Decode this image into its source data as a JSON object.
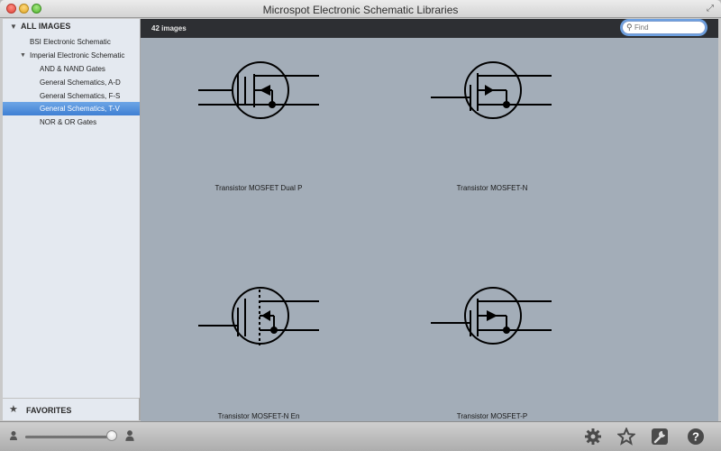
{
  "window": {
    "title": "Microspot Electronic Schematic Libraries"
  },
  "sidebar": {
    "header": "ALL IMAGES",
    "items": [
      {
        "label": "BSI Electronic Schematic"
      },
      {
        "label": "Imperial Electronic Schematic"
      },
      {
        "label": "AND & NAND Gates"
      },
      {
        "label": "General Schematics, A-D"
      },
      {
        "label": "General Schematics, F-S"
      },
      {
        "label": "General Schematics, T-V"
      },
      {
        "label": "NOR & OR Gates"
      }
    ],
    "favorites": "FAVORITES"
  },
  "toolbar": {
    "count": "42 images",
    "search_placeholder": "Find",
    "search_value": ""
  },
  "gallery": [
    {
      "caption": "Transistor MOSFET Dual P",
      "icon": "mosfet-dual-p-symbol"
    },
    {
      "caption": "Transistor MOSFET-N",
      "icon": "mosfet-n-symbol"
    },
    {
      "caption": "Transistor MOSFET-N En",
      "icon": "mosfet-n-enhancement-symbol"
    },
    {
      "caption": "Transistor MOSFET-P",
      "icon": "mosfet-p-symbol"
    }
  ],
  "bottom": {
    "icons": [
      "person-small-icon",
      "zoom-slider",
      "person-large-icon",
      "gear-icon",
      "star-icon",
      "wrench-icon",
      "help-icon"
    ],
    "zoom_fraction": 0.97
  },
  "colors": {
    "selection": "#3e7fd3",
    "gallery_bg": "#a3adb8",
    "topbar": "#2d2f33"
  }
}
